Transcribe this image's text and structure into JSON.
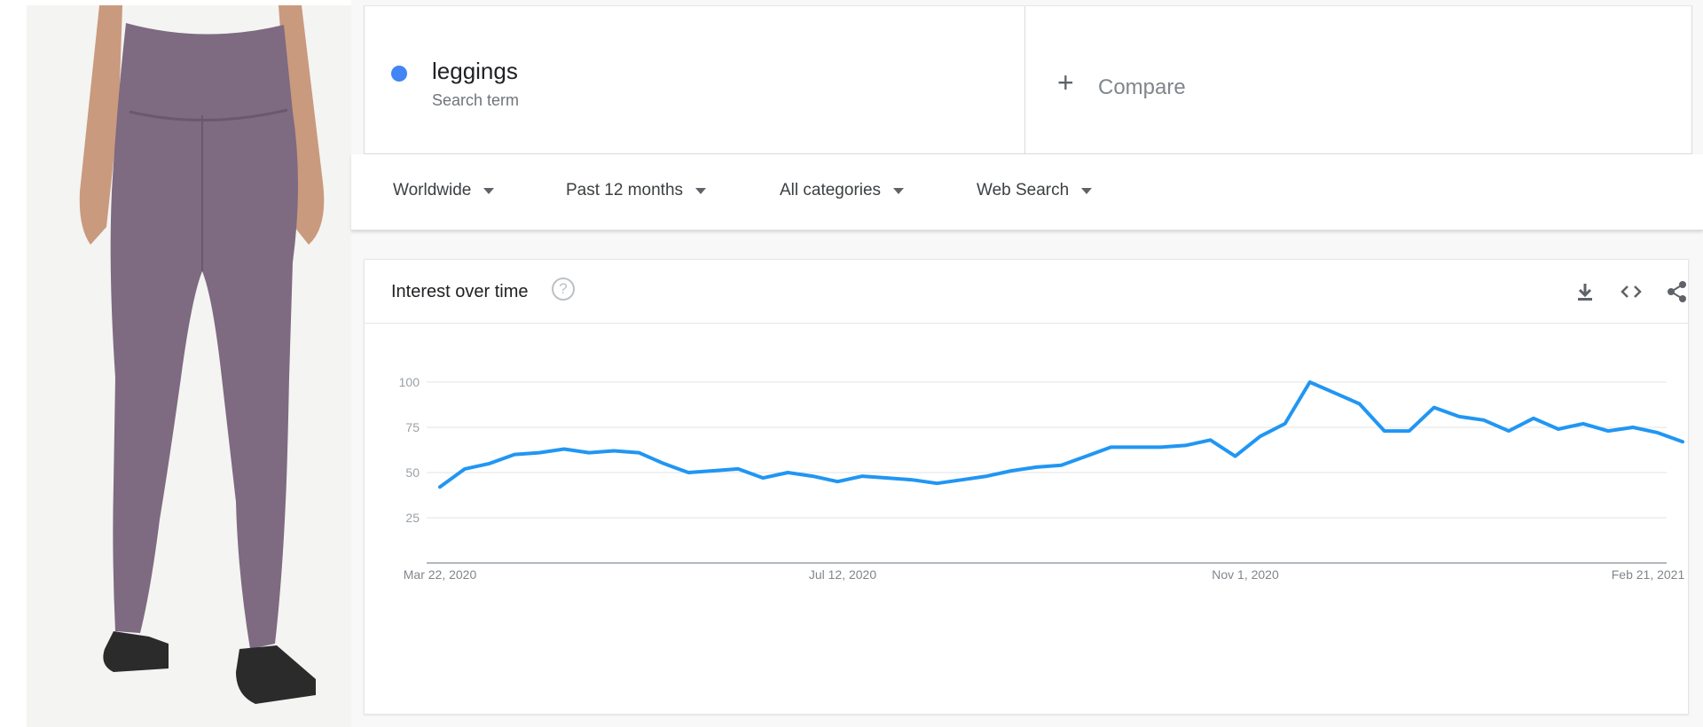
{
  "search_term": {
    "name": "leggings",
    "type": "Search term",
    "color": "#4285f4"
  },
  "compare": {
    "icon": "plus-icon",
    "label": "Compare"
  },
  "filters": [
    {
      "label": "Worldwide"
    },
    {
      "label": "Past 12 months"
    },
    {
      "label": "All categories"
    },
    {
      "label": "Web Search"
    }
  ],
  "chart_card": {
    "title": "Interest over time",
    "help_icon": "?",
    "tools": [
      "download-icon",
      "embed-code-icon",
      "share-icon"
    ]
  },
  "chart_data": {
    "type": "line",
    "title": "",
    "xlabel": "",
    "ylabel": "",
    "x_ticks": [
      "Mar 22, 2020",
      "Jul 12, 2020",
      "Nov 1, 2020",
      "Feb 21, 2021"
    ],
    "y_ticks": [
      25,
      50,
      75,
      100
    ],
    "ylim": [
      0,
      100
    ],
    "grid": true,
    "series": [
      {
        "color": "#2196f3",
        "values": [
          42,
          52,
          55,
          60,
          61,
          63,
          61,
          62,
          61,
          55,
          50,
          51,
          52,
          47,
          50,
          48,
          45,
          48,
          47,
          46,
          44,
          46,
          48,
          51,
          53,
          54,
          59,
          64,
          64,
          64,
          65,
          68,
          59,
          70,
          77,
          100,
          94,
          88,
          73,
          73,
          86,
          81,
          79,
          73,
          80,
          74,
          77,
          73,
          75,
          72,
          67
        ]
      }
    ]
  }
}
